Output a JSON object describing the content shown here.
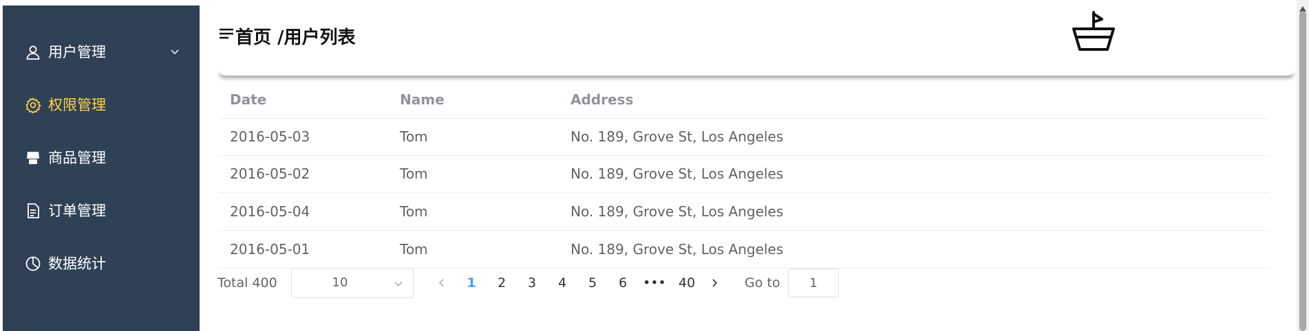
{
  "sidebar": {
    "items": [
      {
        "label": "用户管理",
        "icon": "user-icon",
        "has_submenu": true
      },
      {
        "label": "权限管理",
        "icon": "gear-icon",
        "active": true
      },
      {
        "label": "商品管理",
        "icon": "shop-icon"
      },
      {
        "label": "订单管理",
        "icon": "document-icon"
      },
      {
        "label": "数据统计",
        "icon": "pie-chart-icon"
      }
    ]
  },
  "header": {
    "breadcrumb": "首页 /用户列表",
    "menu_icon": "hamburger-icon",
    "logo_icon": "boat-logo-icon"
  },
  "table": {
    "columns": [
      "Date",
      "Name",
      "Address"
    ],
    "rows": [
      [
        "2016-05-03",
        "Tom",
        "No. 189, Grove St, Los Angeles"
      ],
      [
        "2016-05-02",
        "Tom",
        "No. 189, Grove St, Los Angeles"
      ],
      [
        "2016-05-04",
        "Tom",
        "No. 189, Grove St, Los Angeles"
      ],
      [
        "2016-05-01",
        "Tom",
        "No. 189, Grove St, Los Angeles"
      ]
    ]
  },
  "pagination": {
    "total_label": "Total 400",
    "page_size": "10",
    "pages": [
      "1",
      "2",
      "3",
      "4",
      "5",
      "6",
      "•••",
      "40"
    ],
    "current_page": "1",
    "goto_label": "Go to",
    "goto_value": "1"
  },
  "colors": {
    "sidebar_bg": "#304156",
    "active_menu": "#ffd04b",
    "active_page": "#409eff"
  }
}
